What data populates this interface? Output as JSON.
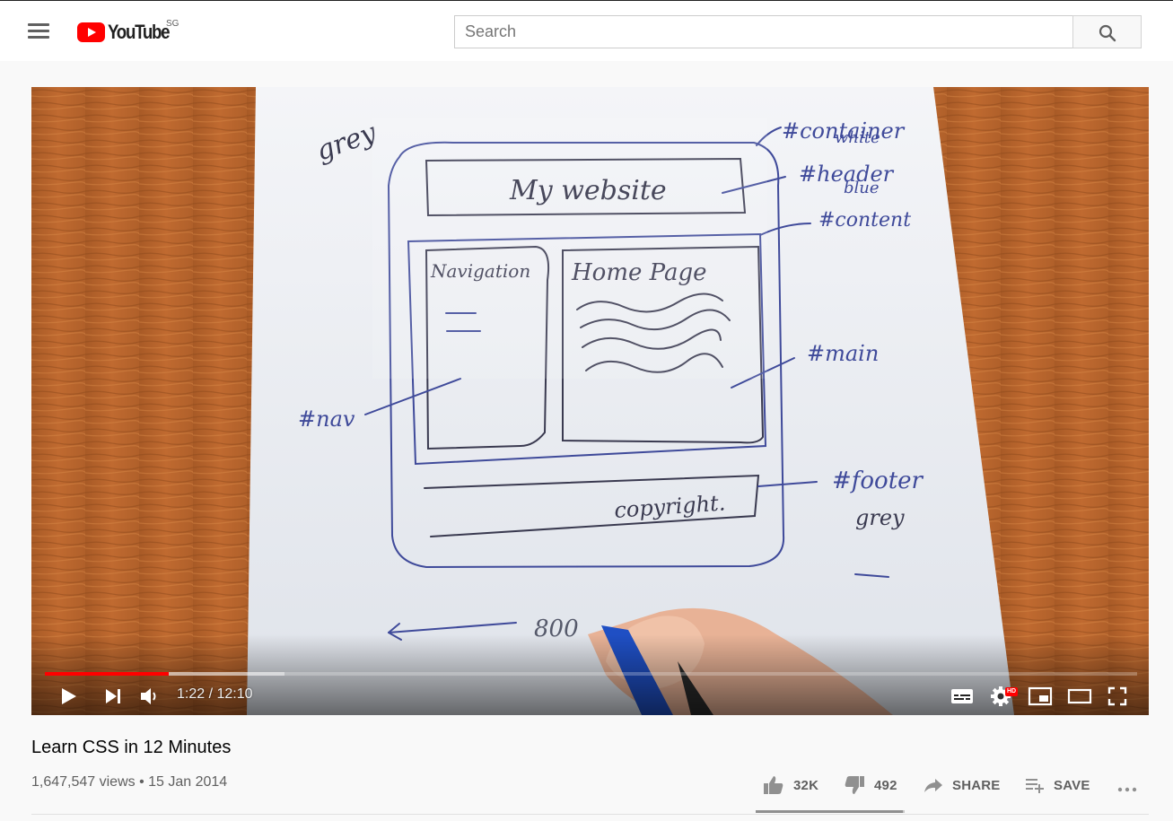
{
  "masthead": {
    "logo_text": "YouTube",
    "country_code": "SG",
    "search_placeholder": "Search",
    "icons": [
      "menu-icon",
      "youtube-logo-icon",
      "search-icon"
    ]
  },
  "player": {
    "current_time": "1:22",
    "duration": "12:10",
    "time_display": "1:22 / 12:10",
    "progress_played_fraction": 0.113,
    "progress_loaded_fraction": 0.219,
    "hd_badge": "HD",
    "video_frame": {
      "description_text": [
        "grey",
        "#container white",
        "My website",
        "#header blue",
        "#content",
        "Navigation",
        "Home Page",
        "#main",
        "#nav",
        "copyright.",
        "#footer grey",
        "800"
      ]
    },
    "icons": [
      "play-icon",
      "next-icon",
      "volume-icon",
      "subtitles-icon",
      "settings-icon",
      "miniplayer-icon",
      "theater-mode-icon",
      "fullscreen-icon"
    ]
  },
  "video": {
    "title": "Learn CSS in 12 Minutes",
    "views_date": "1,647,547 views • 15 Jan 2014",
    "likes": "32K",
    "dislikes": "492",
    "like_fraction": 0.985,
    "share_label": "SHARE",
    "save_label": "SAVE"
  },
  "colors": {
    "brand_red": "#ff0000",
    "page_bg": "#f9f9f9",
    "text_secondary": "#606060"
  }
}
